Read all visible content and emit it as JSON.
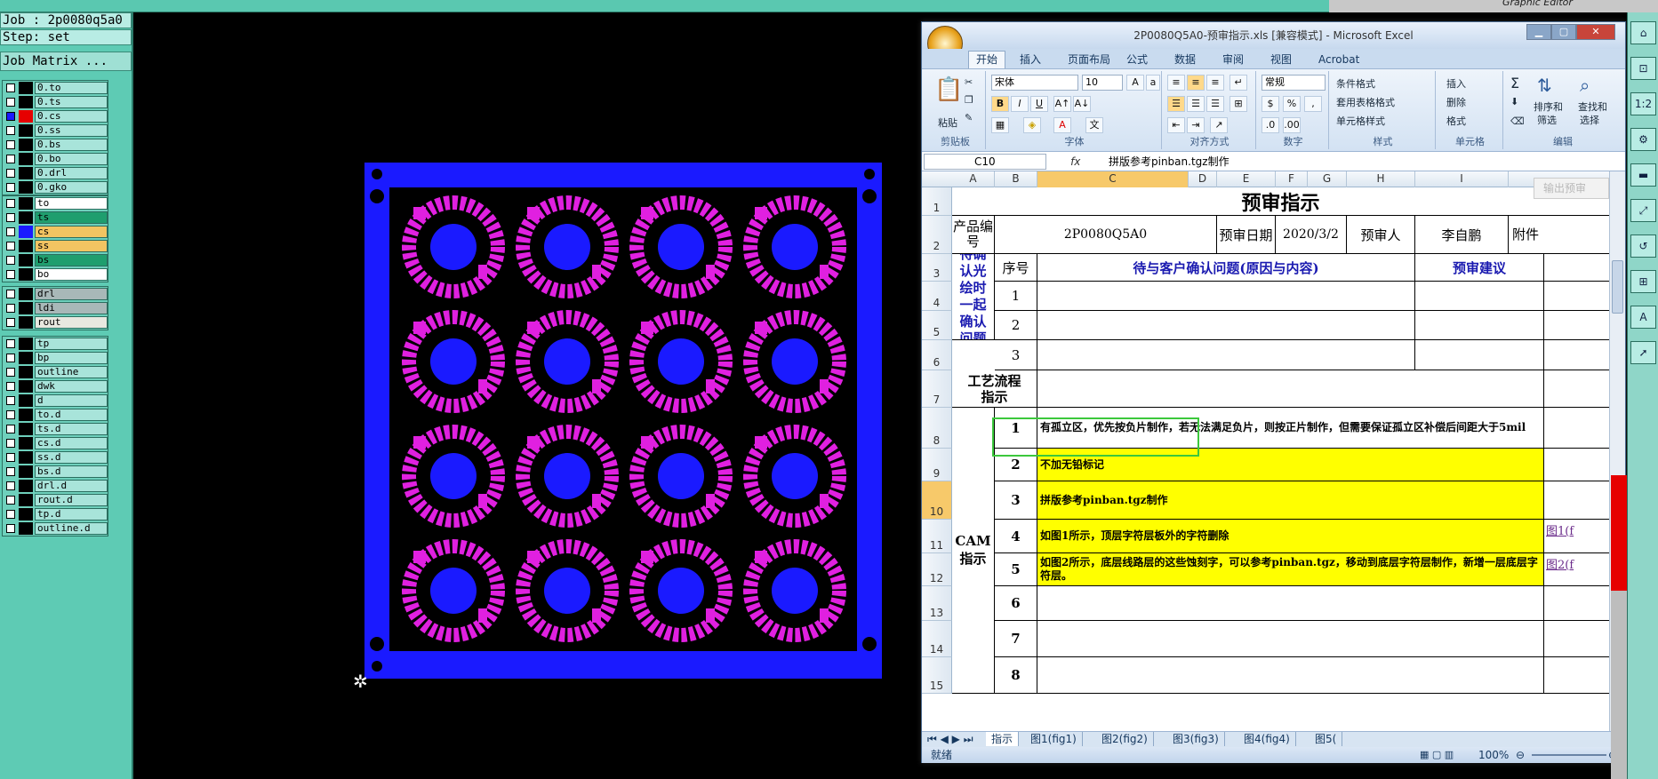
{
  "top_right_title": "Graphic Editor",
  "job": {
    "job_label": "Job : 2p0080q5a0",
    "step_label": "Step: set",
    "matrix_button": "Job Matrix ..."
  },
  "layers_group1": [
    {
      "name": "0.to",
      "color": "#000000",
      "checked": false
    },
    {
      "name": "0.ts",
      "color": "#000000",
      "checked": false
    },
    {
      "name": "0.cs",
      "color": "#e60000",
      "checked": true
    },
    {
      "name": "0.ss",
      "color": "#000000",
      "checked": false
    },
    {
      "name": "0.bs",
      "color": "#000000",
      "checked": false
    },
    {
      "name": "0.bo",
      "color": "#000000",
      "checked": false
    },
    {
      "name": "0.drl",
      "color": "#000000",
      "checked": false
    },
    {
      "name": "0.gko",
      "color": "#000000",
      "checked": false
    }
  ],
  "layers_group2": [
    {
      "name": "to",
      "color": "#000000",
      "fill": "#ffffff",
      "checked": false
    },
    {
      "name": "ts",
      "color": "#000000",
      "fill": "#1f9e6e",
      "checked": false
    },
    {
      "name": "cs",
      "color": "#1a1aff",
      "fill": "#f2c462",
      "checked": false
    },
    {
      "name": "ss",
      "color": "#000000",
      "fill": "#f2c462",
      "checked": false
    },
    {
      "name": "bs",
      "color": "#000000",
      "fill": "#1f9e6e",
      "checked": false
    },
    {
      "name": "bo",
      "color": "#000000",
      "fill": "#ffffff",
      "checked": false
    }
  ],
  "layers_group3": [
    {
      "name": "drl",
      "fill": "#a8b8b8"
    },
    {
      "name": "ldi",
      "fill": "#a8b8b8"
    },
    {
      "name": "rout",
      "fill": "#e8e8e0"
    }
  ],
  "layers_group4": [
    "tp",
    "bp",
    "outline",
    "dwk",
    "d",
    "to.d",
    "ts.d",
    "cs.d",
    "ss.d",
    "bs.d",
    "drl.d",
    "rout.d",
    "tp.d",
    "outline.d"
  ],
  "excel": {
    "title": "2P0080Q5A0-预审指示.xls  [兼容模式] - Microsoft Excel",
    "tabs": [
      "开始",
      "插入",
      "页面布局",
      "公式",
      "数据",
      "审阅",
      "视图",
      "Acrobat"
    ],
    "ribbon": {
      "paste": "粘贴",
      "clipboard": "剪贴板",
      "font_name": "宋体",
      "font_size": "10",
      "font": "字体",
      "align": "对齐方式",
      "number_format": "常规",
      "number": "数字",
      "cond_format": "条件格式",
      "table_format": "套用表格格式",
      "cell_style": "单元格样式",
      "styles": "样式",
      "insert": "插入",
      "delete": "删除",
      "format": "格式",
      "cells": "单元格",
      "sort": "排序和",
      "filter": "筛选",
      "find": "查找和",
      "select": "选择",
      "edit": "编辑"
    },
    "name_box": "C10",
    "formula": "拼版参考pinban.tgz制作",
    "columns": [
      "A",
      "B",
      "C",
      "D",
      "E",
      "F",
      "G",
      "H",
      "I"
    ],
    "rows": [
      "1",
      "2",
      "3",
      "4",
      "5",
      "6",
      "7",
      "8",
      "9",
      "10",
      "11",
      "12",
      "13",
      "14",
      "15"
    ],
    "sheet": {
      "title": "预审指示",
      "export_btn": "输出预审",
      "product_no_label": "产品编号",
      "product_no": "2P0080Q5A0",
      "date_label": "预审日期",
      "date": "2020/3/2",
      "reviewer_label": "预审人",
      "reviewer": "李自鹏",
      "attach_label": "附件",
      "pending_label": "待确认光绘时一起确认问题",
      "seq_label": "序号",
      "issue_label": "待与客户确认问题(原因与内容)",
      "suggest_label": "预审建议",
      "pending_nums": [
        "1",
        "2",
        "3"
      ],
      "process_label": "工艺流程指示",
      "cam_label": "CAM指示",
      "cam_items": [
        {
          "n": "1",
          "text": "有孤立区，优先按负片制作，若无法满足负片，则按正片制作，但需要保证孤立区补偿后间距大于5mil",
          "yellow": false,
          "link": ""
        },
        {
          "n": "2",
          "text": "不加无铅标记",
          "yellow": true,
          "link": ""
        },
        {
          "n": "3",
          "text": "拼版参考pinban.tgz制作",
          "yellow": true,
          "link": ""
        },
        {
          "n": "4",
          "text": "如图1所示，顶层字符层板外的字符删除",
          "yellow": true,
          "link": "图1(f"
        },
        {
          "n": "5",
          "text": "如图2所示，底层线路层的这些蚀刻字，可以参考pinban.tgz，移动到底层字符层制作，新增一层底层字符层。",
          "yellow": true,
          "link": "图2(f"
        },
        {
          "n": "6",
          "text": "",
          "yellow": false,
          "link": ""
        },
        {
          "n": "7",
          "text": "",
          "yellow": false,
          "link": ""
        },
        {
          "n": "8",
          "text": "",
          "yellow": false,
          "link": ""
        }
      ]
    },
    "sheet_tabs": [
      "指示",
      "图1(fig1)",
      "图2(fig2)",
      "图3(fig3)",
      "图4(fig4)",
      "图5("
    ],
    "status": "就绪",
    "zoom": "100%"
  }
}
